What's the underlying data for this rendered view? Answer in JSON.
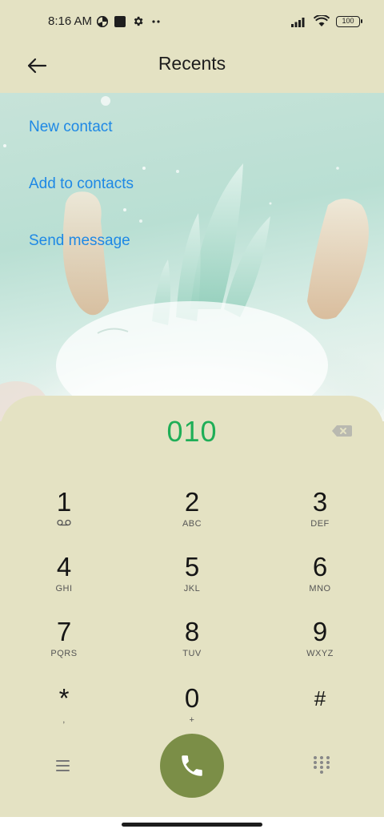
{
  "status_bar": {
    "time": "8:16 AM",
    "battery": "100",
    "icons": [
      "data-saver-icon",
      "square-notification-icon",
      "settings-gear-icon",
      "more-dots-icon",
      "signal-icon",
      "wifi-icon",
      "battery-icon"
    ]
  },
  "header": {
    "title": "Recents",
    "back_icon": "arrow-left-icon"
  },
  "actions": {
    "new_contact": "New contact",
    "add_to_contacts": "Add to contacts",
    "send_message": "Send message"
  },
  "dialer": {
    "number": "010",
    "keys": [
      {
        "digit": "1",
        "sub": ""
      },
      {
        "digit": "2",
        "sub": "ABC"
      },
      {
        "digit": "3",
        "sub": "DEF"
      },
      {
        "digit": "4",
        "sub": "GHI"
      },
      {
        "digit": "5",
        "sub": "JKL"
      },
      {
        "digit": "6",
        "sub": "MNO"
      },
      {
        "digit": "7",
        "sub": "PQRS"
      },
      {
        "digit": "8",
        "sub": "TUV"
      },
      {
        "digit": "9",
        "sub": "WXYZ"
      },
      {
        "digit": "*",
        "sub": ","
      },
      {
        "digit": "0",
        "sub": "+"
      },
      {
        "digit": "#",
        "sub": ""
      }
    ]
  },
  "colors": {
    "background": "#e4e2c3",
    "number": "#1fae57",
    "link": "#1e88e5",
    "call_button": "#7b8e47"
  }
}
